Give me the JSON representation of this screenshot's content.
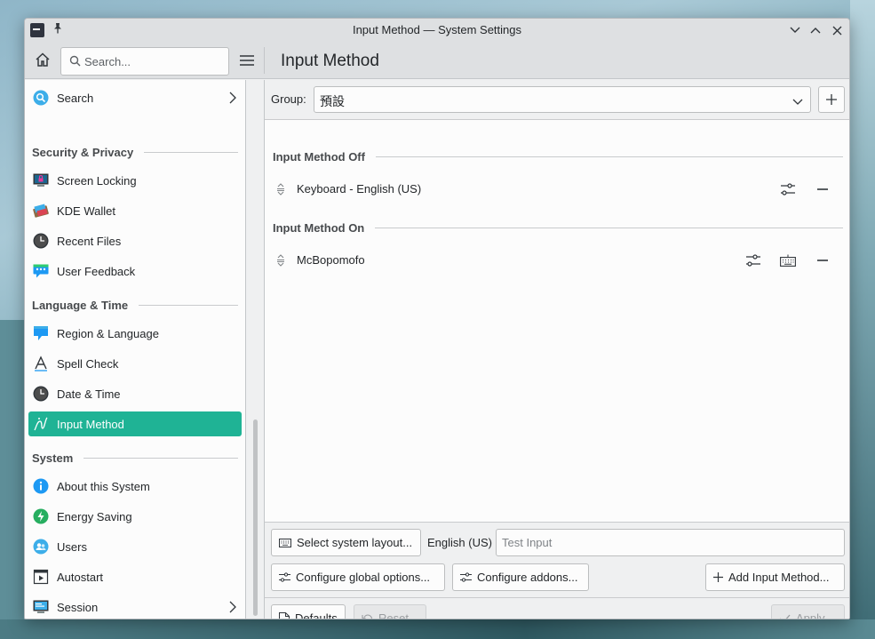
{
  "window": {
    "title": "Input Method — System Settings"
  },
  "header": {
    "search_placeholder": "Search...",
    "page_title": "Input Method"
  },
  "sidebar": {
    "search_item": "Search",
    "sections": {
      "security": "Security & Privacy",
      "language": "Language & Time",
      "system": "System"
    },
    "items": {
      "screen_locking": "Screen Locking",
      "kde_wallet": "KDE Wallet",
      "recent_files": "Recent Files",
      "user_feedback": "User Feedback",
      "region_language": "Region & Language",
      "spell_check": "Spell Check",
      "date_time": "Date & Time",
      "input_method": "Input Method",
      "about": "About this System",
      "energy": "Energy Saving",
      "users": "Users",
      "autostart": "Autostart",
      "session": "Session"
    }
  },
  "main": {
    "group_label": "Group:",
    "group_value": "預設",
    "section_off": "Input Method Off",
    "section_on": "Input Method On",
    "im_off": [
      "Keyboard - English (US)"
    ],
    "im_on": [
      "McBopomofo"
    ],
    "buttons": {
      "select_layout": "Select system layout...",
      "layout_label": "English (US)",
      "test_input_placeholder": "Test Input",
      "configure_global": "Configure global options...",
      "configure_addons": "Configure addons...",
      "add_im": "Add Input Method...",
      "defaults": "Defaults",
      "reset": "Reset",
      "apply": "Apply"
    }
  },
  "colors": {
    "accent": "#1fb395",
    "window_bg": "#eff0f1",
    "view_bg": "#fcfcfc"
  }
}
